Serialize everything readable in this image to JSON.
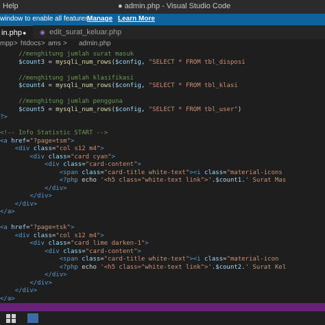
{
  "window": {
    "menu_label": "Help",
    "title": "● admin.php - Visual Studio Code"
  },
  "notification": {
    "message": "window to enable all features.",
    "manage_label": "Manage",
    "learn_more_label": "Learn More"
  },
  "tabs": [
    {
      "label": "in.php",
      "dirty_marker": "●",
      "active": true
    },
    {
      "label": "edit_surat_keluar.php",
      "icon": "php-icon",
      "active": false
    }
  ],
  "breadcrumb": [
    "mpp",
    ">",
    "htdocs",
    ">",
    "ams",
    ">",
    "admin.php"
  ],
  "colors": {
    "background": "#1e1e1e",
    "keyword_var": "#9cdcfe",
    "function": "#dcdcaa",
    "string": "#ce9178",
    "comment": "#6a9955",
    "tag": "#569cd6",
    "attribute": "#9cdcfe",
    "text": "#d4d4d4",
    "statusbar": "#68217a",
    "notification": "#0e639c"
  },
  "code_lines": [
    {
      "segments": [
        {
          "t": "     //menghitung jumlah surat masuk",
          "c": "comment"
        }
      ]
    },
    {
      "segments": [
        {
          "t": "     $count3",
          "c": "var"
        },
        {
          "t": " = ",
          "c": "text"
        },
        {
          "t": "mysqli_num_rows",
          "c": "func"
        },
        {
          "t": "(",
          "c": "text"
        },
        {
          "t": "$config",
          "c": "var"
        },
        {
          "t": ", ",
          "c": "text"
        },
        {
          "t": "\"SELECT * FROM tbl_disposi",
          "c": "string"
        }
      ]
    },
    {
      "segments": [
        {
          "t": "",
          "c": "text"
        }
      ]
    },
    {
      "segments": [
        {
          "t": "     //menghitung jumlah klasifikasi",
          "c": "comment"
        }
      ]
    },
    {
      "segments": [
        {
          "t": "     $count4",
          "c": "var"
        },
        {
          "t": " = ",
          "c": "text"
        },
        {
          "t": "mysqli_num_rows",
          "c": "func"
        },
        {
          "t": "(",
          "c": "text"
        },
        {
          "t": "$config",
          "c": "var"
        },
        {
          "t": ", ",
          "c": "text"
        },
        {
          "t": "\"SELECT * FROM tbl_klasi",
          "c": "string"
        }
      ]
    },
    {
      "segments": [
        {
          "t": "",
          "c": "text"
        }
      ]
    },
    {
      "segments": [
        {
          "t": "     //menghitung jumlah pengguna",
          "c": "comment"
        }
      ]
    },
    {
      "segments": [
        {
          "t": "     $count5",
          "c": "var"
        },
        {
          "t": " = ",
          "c": "text"
        },
        {
          "t": "mysqli_num_rows",
          "c": "func"
        },
        {
          "t": "(",
          "c": "text"
        },
        {
          "t": "$config",
          "c": "var"
        },
        {
          "t": ", ",
          "c": "text"
        },
        {
          "t": "\"SELECT * FROM tbl_user\"",
          "c": "string"
        },
        {
          "t": ")",
          "c": "text"
        }
      ]
    },
    {
      "segments": [
        {
          "t": "?>",
          "c": "tag"
        }
      ]
    },
    {
      "segments": [
        {
          "t": "",
          "c": "text"
        }
      ]
    },
    {
      "segments": [
        {
          "t": "<!-- Info Statistic START -->",
          "c": "comment"
        }
      ]
    },
    {
      "segments": [
        {
          "t": "<a",
          "c": "tag"
        },
        {
          "t": " href",
          "c": "attr"
        },
        {
          "t": "=",
          "c": "text"
        },
        {
          "t": "\"?page=tsm\"",
          "c": "string"
        },
        {
          "t": ">",
          "c": "tag"
        }
      ]
    },
    {
      "segments": [
        {
          "t": "    <div",
          "c": "tag"
        },
        {
          "t": " class",
          "c": "attr"
        },
        {
          "t": "=",
          "c": "text"
        },
        {
          "t": "\"col s12 m4\"",
          "c": "string"
        },
        {
          "t": ">",
          "c": "tag"
        }
      ]
    },
    {
      "segments": [
        {
          "t": "        <div",
          "c": "tag"
        },
        {
          "t": " class",
          "c": "attr"
        },
        {
          "t": "=",
          "c": "text"
        },
        {
          "t": "\"card cyan\"",
          "c": "string"
        },
        {
          "t": ">",
          "c": "tag"
        }
      ]
    },
    {
      "segments": [
        {
          "t": "            <div",
          "c": "tag"
        },
        {
          "t": " class",
          "c": "attr"
        },
        {
          "t": "=",
          "c": "text"
        },
        {
          "t": "\"card-content\"",
          "c": "string"
        },
        {
          "t": ">",
          "c": "tag"
        }
      ]
    },
    {
      "segments": [
        {
          "t": "                <span",
          "c": "tag"
        },
        {
          "t": " class",
          "c": "attr"
        },
        {
          "t": "=",
          "c": "text"
        },
        {
          "t": "\"card-title white-text\"",
          "c": "string"
        },
        {
          "t": "><i",
          "c": "tag"
        },
        {
          "t": " class",
          "c": "attr"
        },
        {
          "t": "=",
          "c": "text"
        },
        {
          "t": "\"material-icons",
          "c": "string"
        }
      ]
    },
    {
      "segments": [
        {
          "t": "                <?php",
          "c": "tag"
        },
        {
          "t": " echo ",
          "c": "text"
        },
        {
          "t": "'<h5 class=\"white-text link\">'",
          "c": "string"
        },
        {
          "t": ".",
          "c": "text"
        },
        {
          "t": "$count1",
          "c": "var"
        },
        {
          "t": ".",
          "c": "text"
        },
        {
          "t": "' Surat Mas",
          "c": "string"
        }
      ]
    },
    {
      "segments": [
        {
          "t": "            </div>",
          "c": "tag"
        }
      ]
    },
    {
      "segments": [
        {
          "t": "        </div>",
          "c": "tag"
        }
      ]
    },
    {
      "segments": [
        {
          "t": "    </div>",
          "c": "tag"
        }
      ]
    },
    {
      "segments": [
        {
          "t": "</a>",
          "c": "tag"
        }
      ]
    },
    {
      "segments": [
        {
          "t": "",
          "c": "text"
        }
      ]
    },
    {
      "segments": [
        {
          "t": "<a",
          "c": "tag"
        },
        {
          "t": " href",
          "c": "attr"
        },
        {
          "t": "=",
          "c": "text"
        },
        {
          "t": "\"?page=tsk\"",
          "c": "string"
        },
        {
          "t": ">",
          "c": "tag"
        }
      ]
    },
    {
      "segments": [
        {
          "t": "    <div",
          "c": "tag"
        },
        {
          "t": " class",
          "c": "attr"
        },
        {
          "t": "=",
          "c": "text"
        },
        {
          "t": "\"col s12 m4\"",
          "c": "string"
        },
        {
          "t": ">",
          "c": "tag"
        }
      ]
    },
    {
      "segments": [
        {
          "t": "        <div",
          "c": "tag"
        },
        {
          "t": " class",
          "c": "attr"
        },
        {
          "t": "=",
          "c": "text"
        },
        {
          "t": "\"card lime darken-1\"",
          "c": "string"
        },
        {
          "t": ">",
          "c": "tag"
        }
      ]
    },
    {
      "segments": [
        {
          "t": "            <div",
          "c": "tag"
        },
        {
          "t": " class",
          "c": "attr"
        },
        {
          "t": "=",
          "c": "text"
        },
        {
          "t": "\"card-content\"",
          "c": "string"
        },
        {
          "t": ">",
          "c": "tag"
        }
      ]
    },
    {
      "segments": [
        {
          "t": "                <span",
          "c": "tag"
        },
        {
          "t": " class",
          "c": "attr"
        },
        {
          "t": "=",
          "c": "text"
        },
        {
          "t": "\"card-title white-text\"",
          "c": "string"
        },
        {
          "t": "><i",
          "c": "tag"
        },
        {
          "t": " class",
          "c": "attr"
        },
        {
          "t": "=",
          "c": "text"
        },
        {
          "t": "\"material-icon",
          "c": "string"
        }
      ]
    },
    {
      "segments": [
        {
          "t": "                <?php",
          "c": "tag"
        },
        {
          "t": " echo ",
          "c": "text"
        },
        {
          "t": "'<h5 class=\"white-text link\">'",
          "c": "string"
        },
        {
          "t": ".",
          "c": "text"
        },
        {
          "t": "$count2",
          "c": "var"
        },
        {
          "t": ".",
          "c": "text"
        },
        {
          "t": "' Surat Kel",
          "c": "string"
        }
      ]
    },
    {
      "segments": [
        {
          "t": "            </div>",
          "c": "tag"
        }
      ]
    },
    {
      "segments": [
        {
          "t": "        </div>",
          "c": "tag"
        }
      ]
    },
    {
      "segments": [
        {
          "t": "    </div>",
          "c": "tag"
        }
      ]
    },
    {
      "segments": [
        {
          "t": "</a>",
          "c": "tag"
        }
      ]
    }
  ],
  "taskbar": {
    "icons": [
      "windows-start-icon",
      "app-icon"
    ]
  }
}
